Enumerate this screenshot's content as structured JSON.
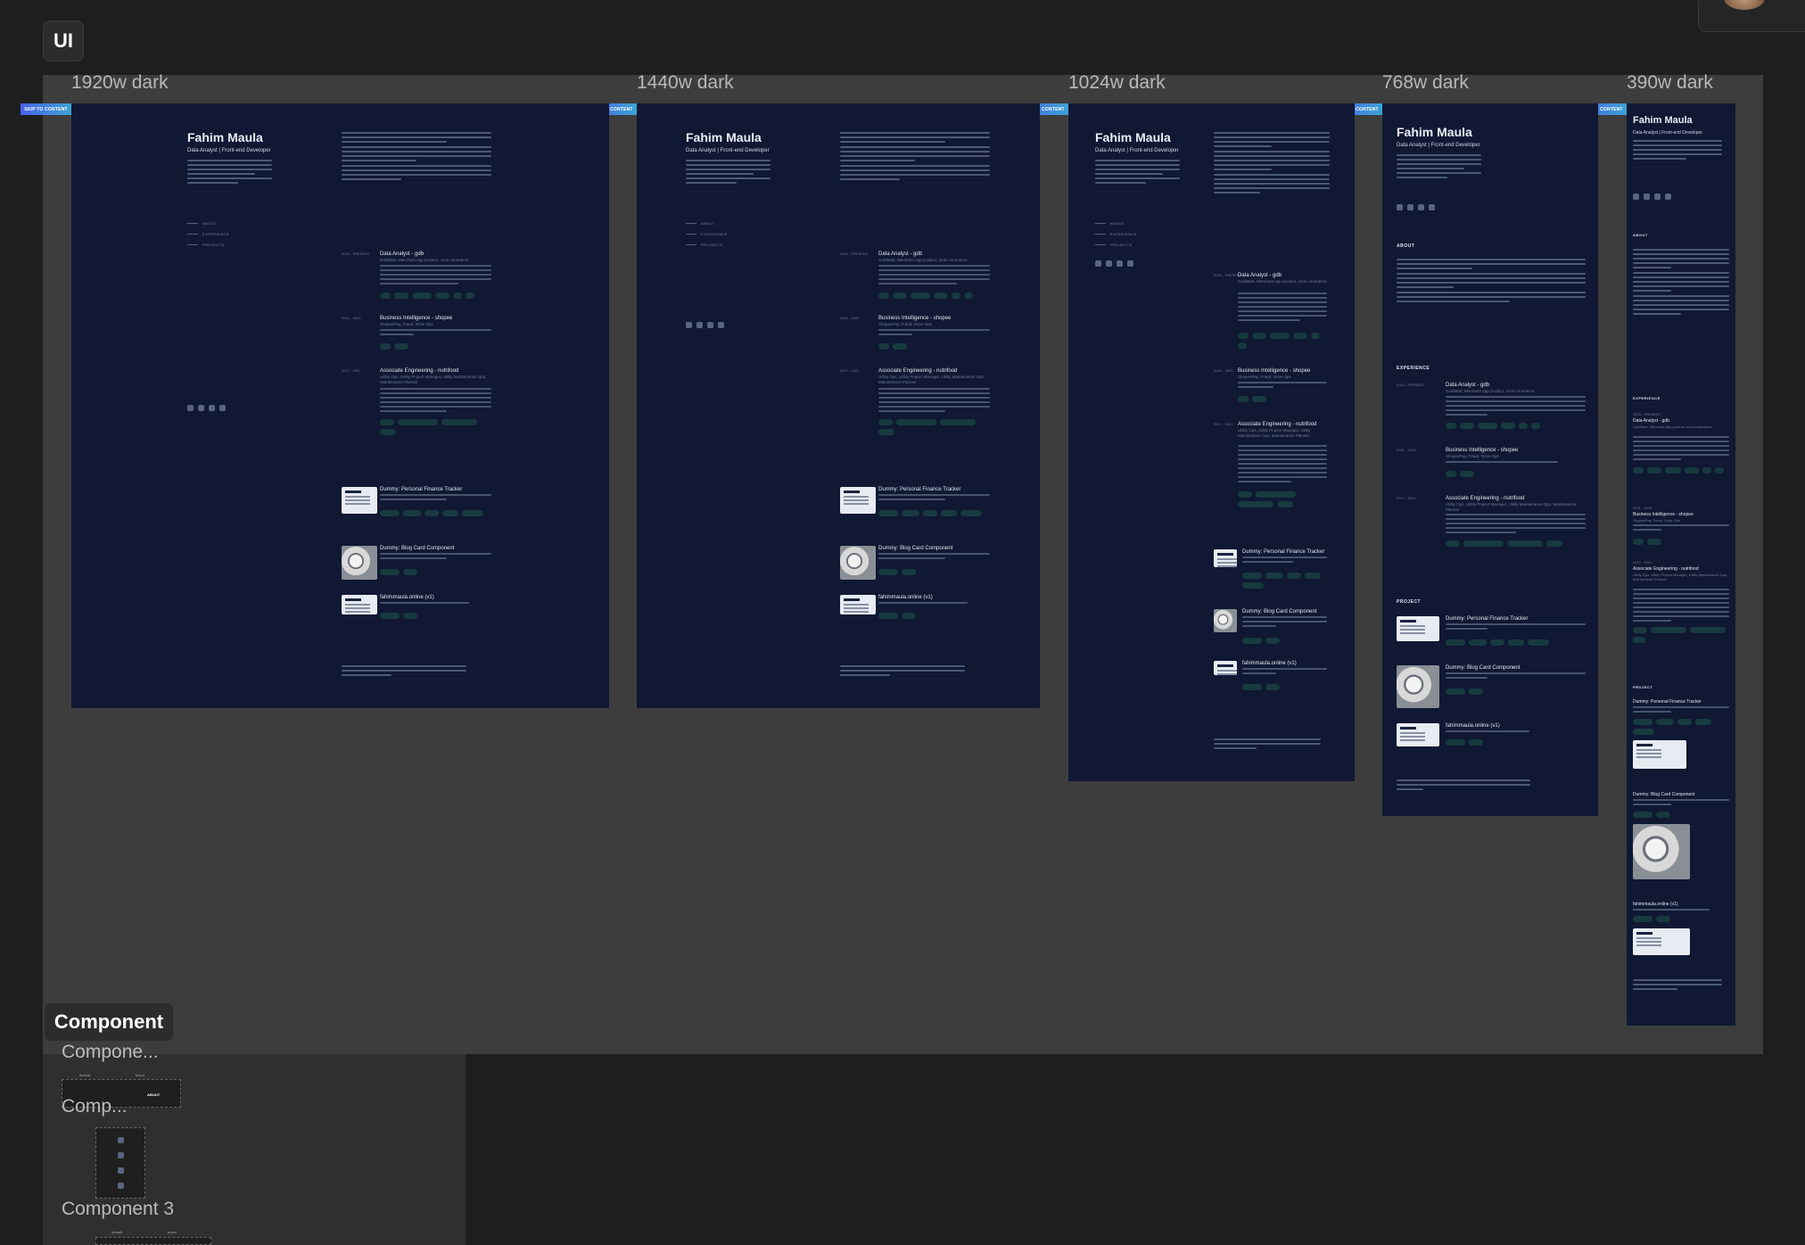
{
  "canvas": {
    "section_title": "UI",
    "component_section_title": "Component"
  },
  "frames": [
    {
      "label": "1920w dark"
    },
    {
      "label": "1440w dark"
    },
    {
      "label": "1024w dark"
    },
    {
      "label": "768w dark"
    },
    {
      "label": "390w dark"
    }
  ],
  "portfolio": {
    "skip_label": "SKIP TO CONTENT",
    "name": "Fahim Maula",
    "role": "Data Analyst | Front-end Developer",
    "nav": [
      "ABOUT",
      "EXPERIENCE",
      "PROJECTS"
    ],
    "about_heading": "ABOUT",
    "experience_heading": "EXPERIENCE",
    "project_heading": "PROJECT",
    "experience": [
      {
        "date": "2023 - PRESENT",
        "title": "Data Analyst - gdb",
        "sub": "GoldMart, Merchant App product, omni commerce"
      },
      {
        "date": "2021 - 2023",
        "title": "Business Intelligence - shopee",
        "sub": "ShopeePay, Fraud, Drive Ops"
      },
      {
        "date": "2017 - 2021",
        "title": "Associate Engineering - nutrifood",
        "sub": "Utility Ops, Utility Project Manager, Utility Maintenance Ops, Maintenance Planner"
      }
    ],
    "projects": [
      {
        "title": "Dummy: Personal Finance Tracker"
      },
      {
        "title": "Dummy: Blog Card Component"
      },
      {
        "title": "fahimmaula.online (v1)"
      }
    ]
  },
  "components": {
    "labels": [
      "Compone...",
      "Comp...",
      "Component 3"
    ],
    "small_labels": [
      "default",
      "hover",
      "ABOUT"
    ]
  }
}
